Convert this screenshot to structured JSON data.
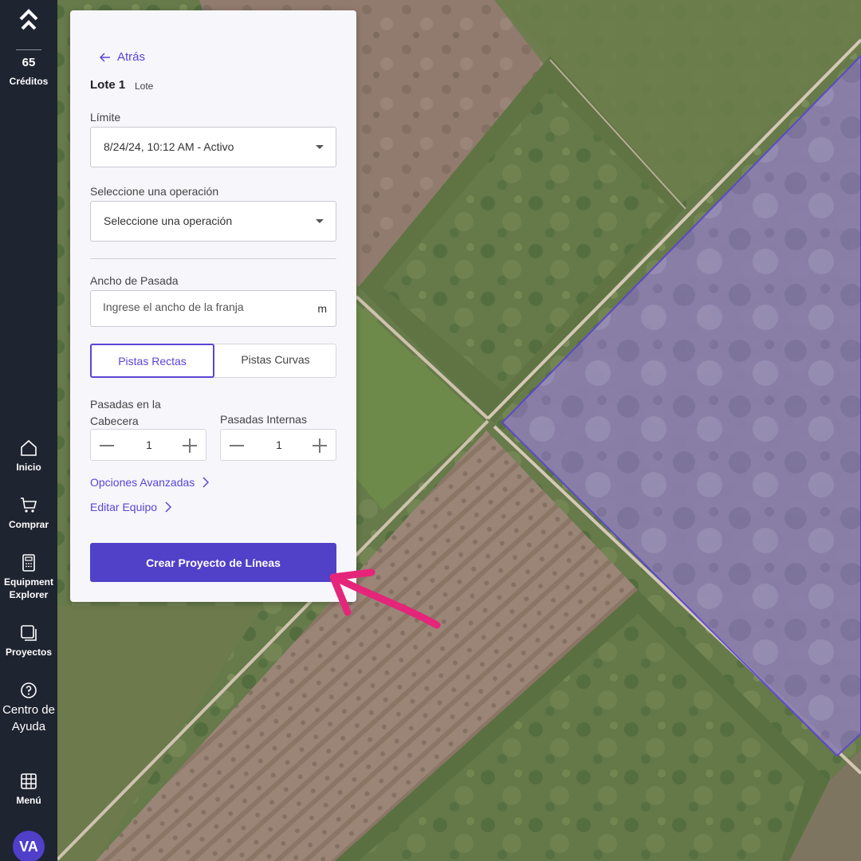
{
  "nav": {
    "credits_count": "65",
    "credits_label": "Créditos",
    "items": [
      {
        "label": "Inicio",
        "icon": "home-icon"
      },
      {
        "label": "Comprar",
        "icon": "cart-icon"
      },
      {
        "label": "Equipment Explorer",
        "icon": "calculator-icon"
      },
      {
        "label": "Proyectos",
        "icon": "projects-icon"
      },
      {
        "label": "Centro de Ayuda",
        "icon": "help-icon"
      },
      {
        "label": "Menú",
        "icon": "grid-icon"
      }
    ],
    "avatar_initials": "VA"
  },
  "panel": {
    "back_label": "Atrás",
    "lote_name": "Lote 1",
    "lote_type": "Lote",
    "limit_label": "Límite",
    "limit_value": "8/24/24, 10:12 AM - Activo",
    "operation_label": "Seleccione una operación",
    "operation_value": "Seleccione una operación",
    "swath_label": "Ancho de Pasada",
    "swath_placeholder": "Ingrese el ancho de la franja",
    "swath_unit": "m",
    "track_options": [
      "Pistas Rectas",
      "Pistas Curvas"
    ],
    "selected_track": "Pistas Rectas",
    "headland_label": "Pasadas en la Cabecera",
    "headland_value": "1",
    "inner_label": "Pasadas Internas",
    "inner_value": "1",
    "advanced_link": "Opciones Avanzadas",
    "equipment_link": "Editar Equipo",
    "create_button": "Crear Proyecto de Líneas"
  },
  "colors": {
    "accent": "#5140c8",
    "nav_bg": "#1e2430",
    "field_overlay": "#8a78d6",
    "annotation_arrow": "#e5257a"
  }
}
